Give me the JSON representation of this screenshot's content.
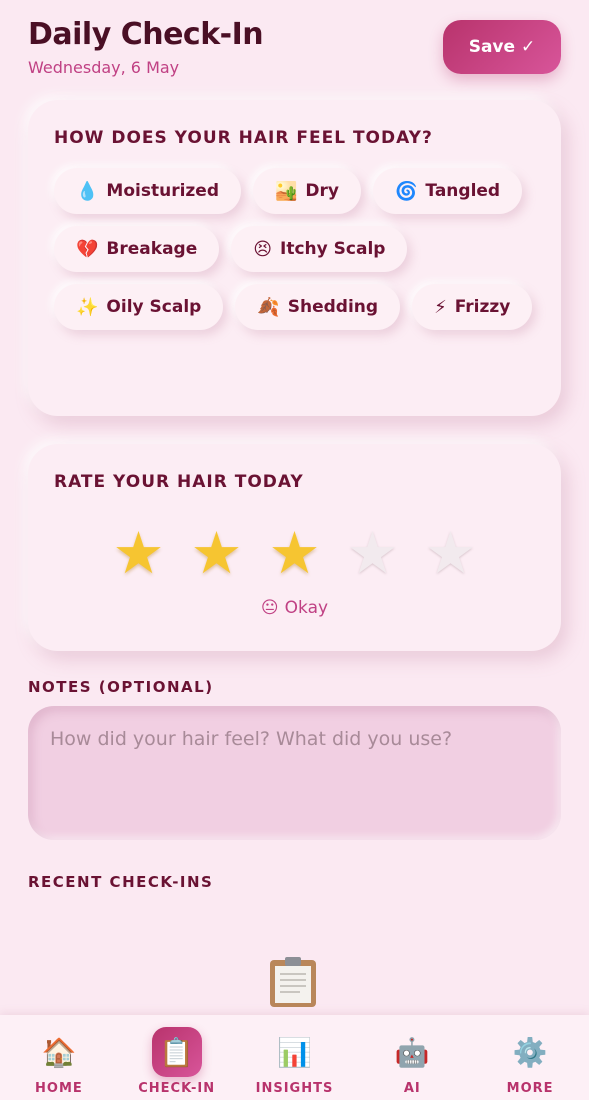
{
  "header": {
    "title": "Daily Check-In",
    "date": "Wednesday, 6 May",
    "save_label": "Save",
    "save_icon": "✓"
  },
  "feel_card": {
    "heading": "HOW DOES YOUR HAIR FEEL TODAY?",
    "chips": [
      {
        "emoji": "💧",
        "label": "Moisturized"
      },
      {
        "emoji": "🏜️",
        "label": "Dry"
      },
      {
        "emoji": "🌀",
        "label": "Tangled"
      },
      {
        "emoji": "💔",
        "label": "Breakage"
      },
      {
        "emoji": "😣",
        "label": "Itchy Scalp"
      },
      {
        "emoji": "✨",
        "label": "Oily Scalp"
      },
      {
        "emoji": "🍂",
        "label": "Shedding"
      },
      {
        "emoji": "⚡",
        "label": "Frizzy"
      }
    ]
  },
  "rating_card": {
    "heading": "RATE YOUR HAIR TODAY",
    "rating": 3,
    "max_rating": 5,
    "rating_emoji": "😐",
    "rating_text": "Okay"
  },
  "notes": {
    "label": "NOTES (OPTIONAL)",
    "value": "",
    "placeholder": "How did your hair feel? What did you use?"
  },
  "recent": {
    "label": "RECENT CHECK-INS",
    "empty_icon": "clipboard-icon"
  },
  "tabbar": {
    "tabs": [
      {
        "icon": "🏠",
        "label": "HOME",
        "active": false
      },
      {
        "icon": "📋",
        "label": "CHECK-IN",
        "active": true
      },
      {
        "icon": "📊",
        "label": "INSIGHTS",
        "active": false
      },
      {
        "icon": "🤖",
        "label": "AI",
        "active": false
      },
      {
        "icon": "⚙️",
        "label": "MORE",
        "active": false
      }
    ]
  },
  "colors": {
    "background": "#fbe9f2",
    "accent": "#c04184",
    "accent_dark": "#6a1233",
    "star_filled": "#f6c531"
  }
}
